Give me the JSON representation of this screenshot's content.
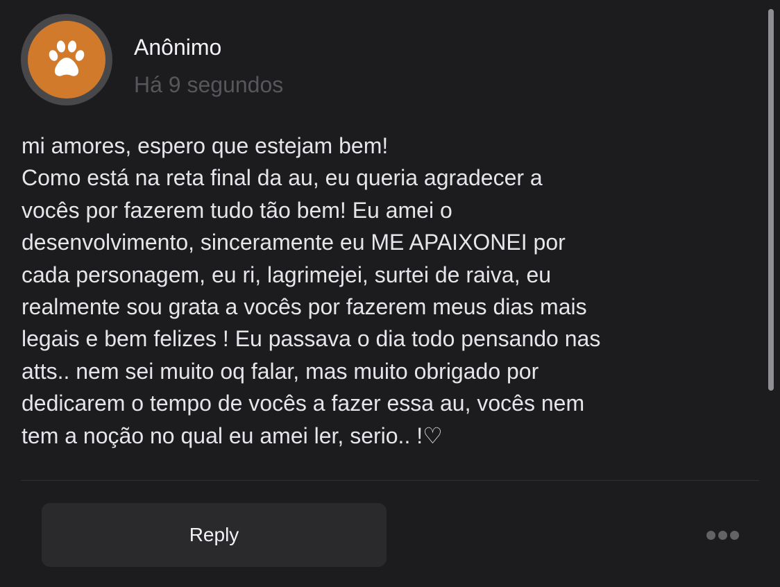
{
  "post": {
    "author": "Anônimo",
    "timestamp": "Há 9 segundos",
    "avatar_icon": "paw-icon",
    "avatar_color": "#d27a2c",
    "message_lines": [
      "mi amores, espero que estejam bem!",
      "Como está na reta final da au, eu queria agradecer a",
      "vocês por fazerem tudo tão bem! Eu amei o",
      "desenvolvimento, sinceramente eu ME APAIXONEI por",
      "cada personagem, eu ri, lagrimejei, surtei de raiva, eu",
      "realmente sou grata a vocês por fazerem meus dias mais",
      "legais e bem felizes ! Eu passava o dia todo pensando nas",
      "atts.. nem sei muito oq falar, mas muito obrigado por",
      "dedicarem o tempo de vocês a fazer essa au, vocês nem",
      "tem a noção no qual eu amei ler, serio.. !♡"
    ]
  },
  "actions": {
    "reply_label": "Reply",
    "more_icon": "more-horizontal-icon"
  }
}
